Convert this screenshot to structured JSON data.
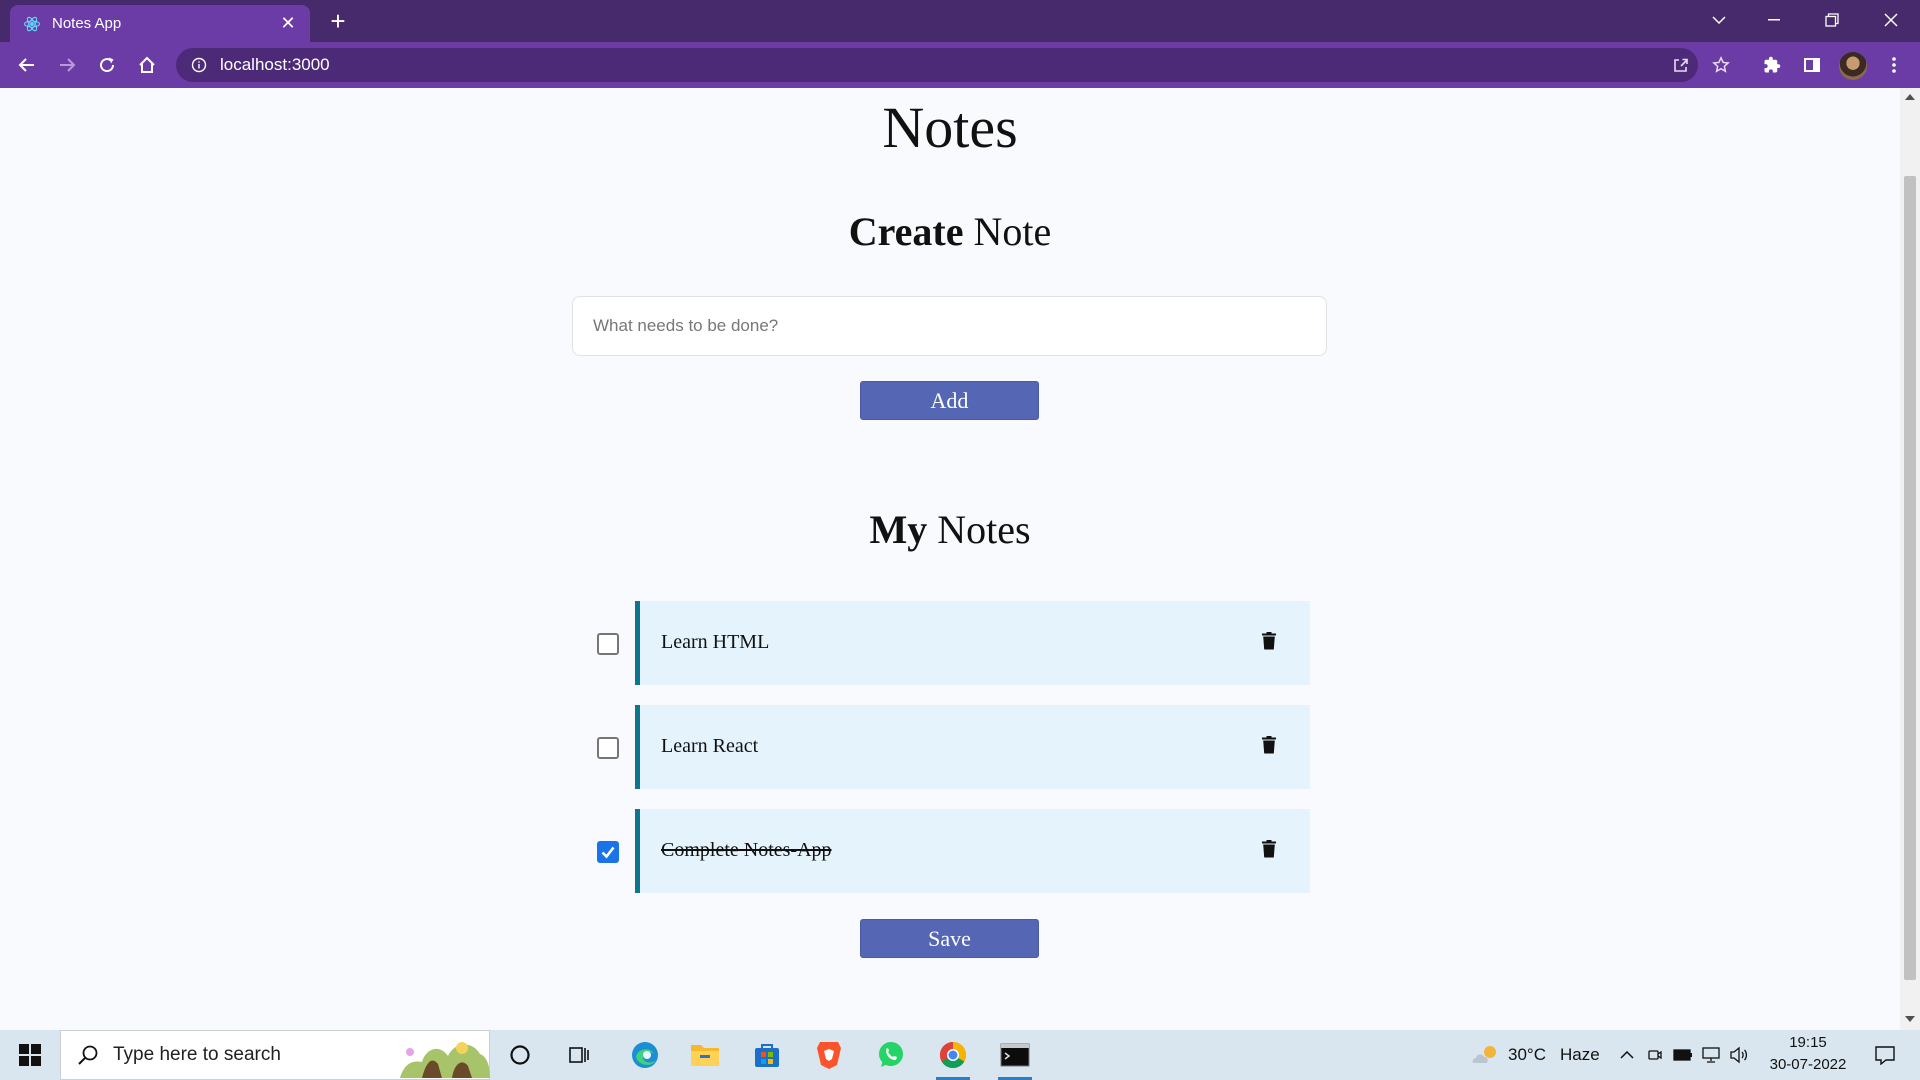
{
  "browser": {
    "tab_title": "Notes App",
    "tab_close": "✕",
    "new_tab": "+",
    "url": "localhost:3000",
    "colors": {
      "frame": "#472a6b",
      "toolbar": "#6c3ca6",
      "omnibox": "#4c2a78"
    }
  },
  "page": {
    "title": "Notes",
    "create_heading_bold": "Create",
    "create_heading_rest": "Note",
    "input_placeholder": "What needs to be done?",
    "add_label": "Add",
    "list_heading_bold": "My",
    "list_heading_rest": "Notes",
    "notes": [
      {
        "text": "Learn HTML",
        "done": false
      },
      {
        "text": "Learn React",
        "done": false
      },
      {
        "text": "Complete Notes-App",
        "done": true
      }
    ],
    "save_label": "Save",
    "colors": {
      "button": "#5566b5",
      "card": "#e5f4fc",
      "card_border": "#0e7490",
      "checkbox_checked": "#1a73e8"
    }
  },
  "taskbar": {
    "search_placeholder": "Type here to search",
    "weather_temp": "30°C",
    "weather_desc": "Haze",
    "time": "19:15",
    "date": "30-07-2022"
  }
}
